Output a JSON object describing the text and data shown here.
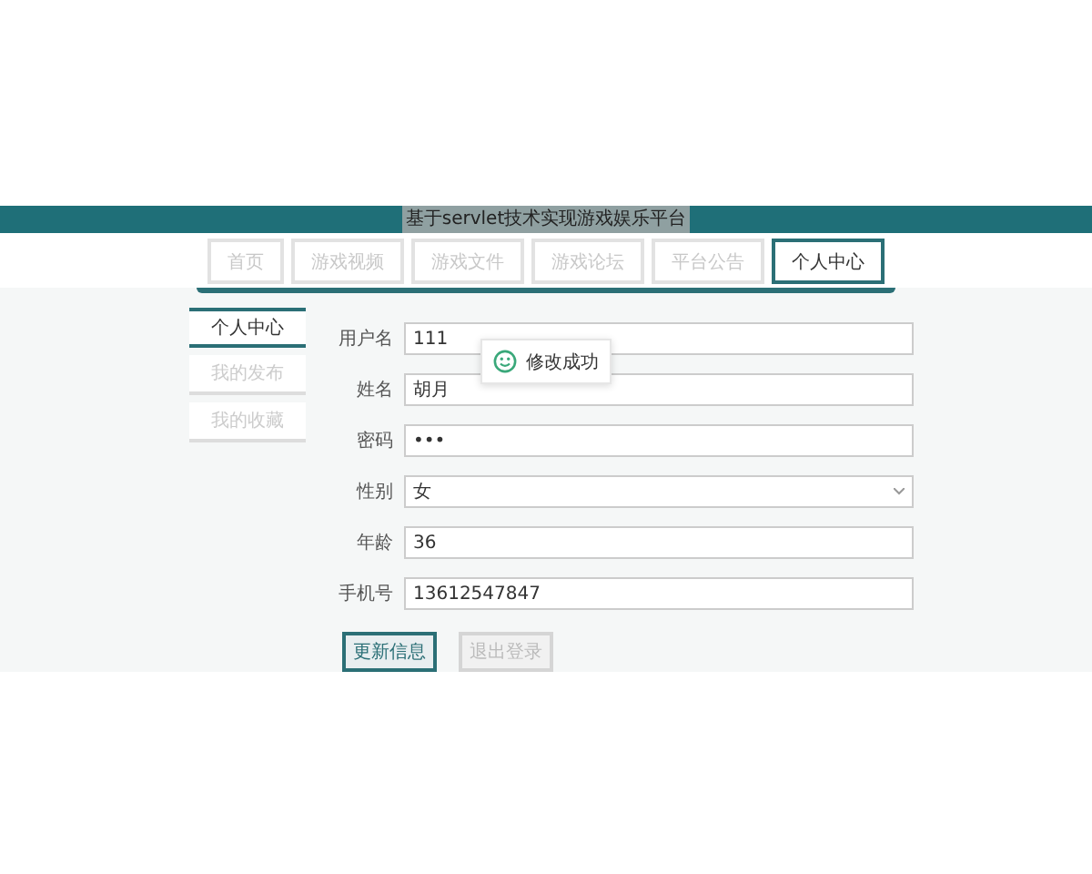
{
  "site_title": "基于servlet技术实现游戏娱乐平台",
  "nav_tabs": [
    {
      "label": "首页",
      "selected": false
    },
    {
      "label": "游戏视频",
      "selected": false
    },
    {
      "label": "游戏文件",
      "selected": false
    },
    {
      "label": "游戏论坛",
      "selected": false
    },
    {
      "label": "平台公告",
      "selected": false
    },
    {
      "label": "个人中心",
      "selected": true
    }
  ],
  "sidebar": {
    "items": [
      {
        "label": "个人中心",
        "selected": true
      },
      {
        "label": "我的发布",
        "selected": false
      },
      {
        "label": "我的收藏",
        "selected": false
      }
    ]
  },
  "form": {
    "fields": [
      {
        "label": "用户名",
        "kind": "text",
        "value": "111"
      },
      {
        "label": "姓名",
        "kind": "text",
        "value": "胡月"
      },
      {
        "label": "密码",
        "kind": "text",
        "value": "•••"
      },
      {
        "label": "性别",
        "kind": "select",
        "value": "女"
      },
      {
        "label": "年龄",
        "kind": "text",
        "value": "36"
      },
      {
        "label": "手机号",
        "kind": "text",
        "value": "13612547847"
      }
    ],
    "buttons": [
      {
        "label": "更新信息",
        "disabled": false
      },
      {
        "label": "退出登录",
        "disabled": true
      }
    ]
  },
  "toast": {
    "message": "修改成功"
  }
}
